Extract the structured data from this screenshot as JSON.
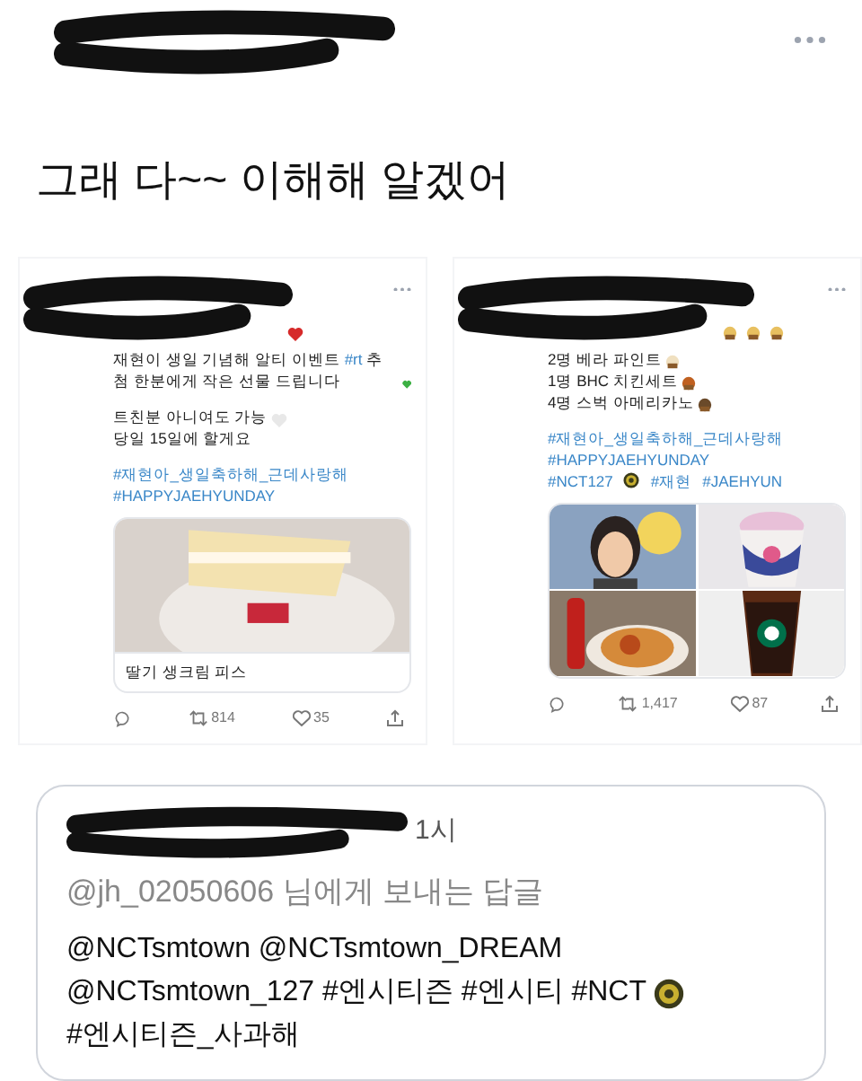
{
  "message": "그래 다~~ 이해해 알겠어",
  "screenshots": [
    {
      "paragraphs": [
        [
          {
            "text": "재현이 생일 기념해 알티 이벤트 "
          },
          {
            "text": "#rt",
            "link": true
          },
          {
            "text": " 추첨 한분에게 작은 선물 드립니다"
          }
        ],
        [
          {
            "text": "트친분 아니여도 가능"
          }
        ],
        [
          {
            "text": "당일 15일에 할게요"
          }
        ]
      ],
      "hashtags": [
        [
          "#재현아_생일축하해_근데사랑해"
        ],
        [
          "#HAPPYJAEHYUNDAY"
        ]
      ],
      "media": [
        {
          "kind": "picture"
        }
      ],
      "caption": "딸기 생크림 피스",
      "retweets": "814",
      "likes": "35"
    },
    {
      "paragraphs": [
        [
          {
            "text": "2명 베라 파인트"
          }
        ],
        [
          {
            "text": "1명 BHC 치킨세트"
          }
        ],
        [
          {
            "text": "4명 스벅 아메리카노"
          }
        ]
      ],
      "hashtags": [
        [
          "#재현아_생일축하해_근데사랑해"
        ],
        [
          "#HAPPYJAEHYUNDAY"
        ],
        [
          "#NCT127",
          "#재현",
          "#JAEHYUN"
        ]
      ],
      "media": [
        {
          "kind": "picture"
        },
        {
          "kind": "picture"
        },
        {
          "kind": "picture"
        },
        {
          "kind": "picture"
        }
      ],
      "retweets": "1,417",
      "likes": "87"
    }
  ],
  "reply": {
    "time": "1시",
    "replying_to": "@jh_02050606 님에게 보내는 답글",
    "lines": [
      "@NCTsmtown @NCTsmtown_DREAM",
      "@NCTsmtown_127 #엔시티즌 #엔시티 #NCT",
      "#엔시티즌_사과해"
    ]
  }
}
